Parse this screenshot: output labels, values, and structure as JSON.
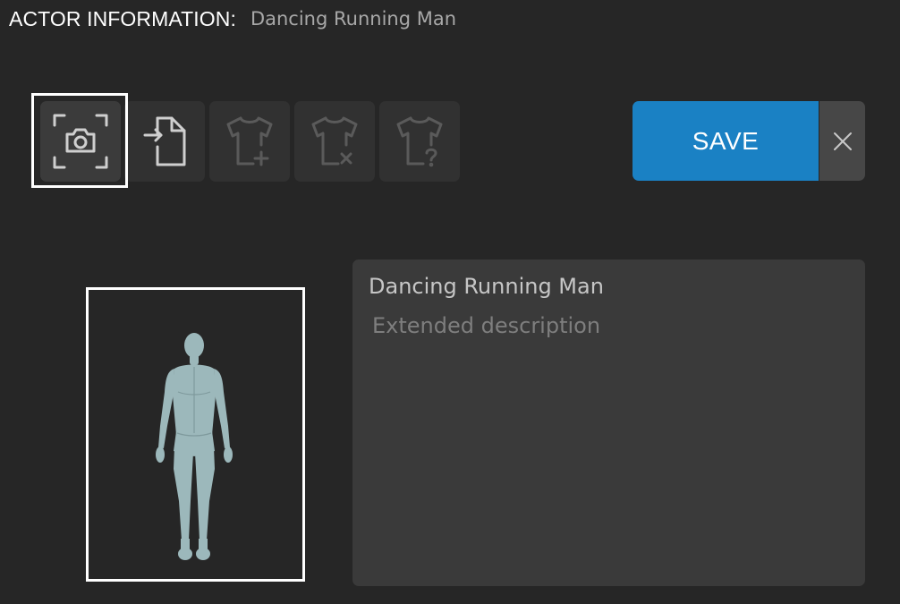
{
  "header": {
    "label": "ACTOR INFORMATION:",
    "actor_name": "Dancing Running Man"
  },
  "toolbar": {
    "buttons": [
      {
        "id": "snapshot",
        "icon": "camera-capture-icon",
        "enabled": true,
        "selected": true
      },
      {
        "id": "import",
        "icon": "file-import-icon",
        "enabled": true,
        "selected": false
      },
      {
        "id": "add-outfit",
        "icon": "shirt-add-icon",
        "enabled": false,
        "selected": false
      },
      {
        "id": "remove-outfit",
        "icon": "shirt-remove-icon",
        "enabled": false,
        "selected": false
      },
      {
        "id": "outfit-help",
        "icon": "shirt-help-icon",
        "enabled": false,
        "selected": false
      }
    ],
    "save_label": "SAVE",
    "close_icon": "close-icon"
  },
  "preview": {
    "icon": "actor-figure-thumbnail"
  },
  "description": {
    "title": "Dancing Running Man",
    "value": "",
    "placeholder": "Extended description"
  },
  "colors": {
    "background": "#262626",
    "button_bg": "#313131",
    "button_active_bg": "#3b3b3b",
    "accent": "#1a81c4",
    "panel_bg": "#3a3a3a",
    "icon_enabled": "#cfcfcf",
    "icon_disabled": "#5a5a5a",
    "figure": "#9cb8bb"
  }
}
